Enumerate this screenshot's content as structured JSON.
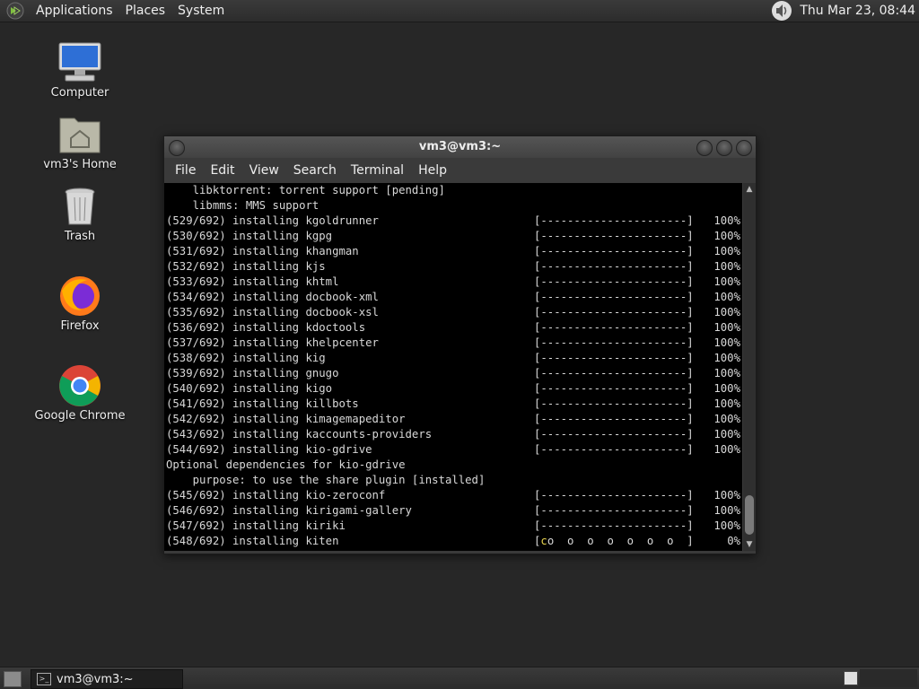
{
  "top_panel": {
    "menus": [
      "Applications",
      "Places",
      "System"
    ],
    "clock": "Thu Mar 23, 08:44"
  },
  "desktop_icons": [
    {
      "label": "Computer"
    },
    {
      "label": "vm3's Home"
    },
    {
      "label": "Trash"
    },
    {
      "label": "Firefox"
    },
    {
      "label": "Google Chrome"
    }
  ],
  "window": {
    "title": "vm3@vm3:~",
    "menus": [
      "File",
      "Edit",
      "View",
      "Search",
      "Terminal",
      "Help"
    ],
    "terminal_lines": [
      {
        "text": "    libktorrent: torrent support [pending]"
      },
      {
        "text": "    libmms: MMS support"
      },
      {
        "text": "(529/692) installing kgoldrunner",
        "bar": "[----------------------]",
        "pct": "100%"
      },
      {
        "text": "(530/692) installing kgpg",
        "bar": "[----------------------]",
        "pct": "100%"
      },
      {
        "text": "(531/692) installing khangman",
        "bar": "[----------------------]",
        "pct": "100%"
      },
      {
        "text": "(532/692) installing kjs",
        "bar": "[----------------------]",
        "pct": "100%"
      },
      {
        "text": "(533/692) installing khtml",
        "bar": "[----------------------]",
        "pct": "100%"
      },
      {
        "text": "(534/692) installing docbook-xml",
        "bar": "[----------------------]",
        "pct": "100%"
      },
      {
        "text": "(535/692) installing docbook-xsl",
        "bar": "[----------------------]",
        "pct": "100%"
      },
      {
        "text": "(536/692) installing kdoctools",
        "bar": "[----------------------]",
        "pct": "100%"
      },
      {
        "text": "(537/692) installing khelpcenter",
        "bar": "[----------------------]",
        "pct": "100%"
      },
      {
        "text": "(538/692) installing kig",
        "bar": "[----------------------]",
        "pct": "100%"
      },
      {
        "text": "(539/692) installing gnugo",
        "bar": "[----------------------]",
        "pct": "100%"
      },
      {
        "text": "(540/692) installing kigo",
        "bar": "[----------------------]",
        "pct": "100%"
      },
      {
        "text": "(541/692) installing killbots",
        "bar": "[----------------------]",
        "pct": "100%"
      },
      {
        "text": "(542/692) installing kimagemapeditor",
        "bar": "[----------------------]",
        "pct": "100%"
      },
      {
        "text": "(543/692) installing kaccounts-providers",
        "bar": "[----------------------]",
        "pct": "100%"
      },
      {
        "text": "(544/692) installing kio-gdrive",
        "bar": "[----------------------]",
        "pct": "100%"
      },
      {
        "text": "Optional dependencies for kio-gdrive"
      },
      {
        "text": "    purpose: to use the share plugin [installed]"
      },
      {
        "text": "(545/692) installing kio-zeroconf",
        "bar": "[----------------------]",
        "pct": "100%"
      },
      {
        "text": "(546/692) installing kirigami-gallery",
        "bar": "[----------------------]",
        "pct": "100%"
      },
      {
        "text": "(547/692) installing kiriki",
        "bar": "[----------------------]",
        "pct": "100%"
      },
      {
        "text": "(548/692) installing kiten",
        "bar_prefix": "[",
        "bar_pac": "c",
        "bar": "o  o  o  o  o  o  o  ]",
        "pct": "0%"
      }
    ]
  },
  "taskbar": {
    "task_label": "vm3@vm3:~"
  },
  "colors": {
    "desktop": "#272727",
    "terminal_bg": "#000000",
    "pacman": "#e8d44d"
  }
}
